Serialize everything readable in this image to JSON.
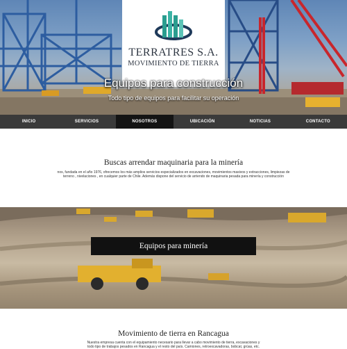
{
  "logo": {
    "title": "TERRATRES S.A.",
    "subtitle": "MOVIMIENTO DE TIERRA"
  },
  "hero": {
    "title": "Equipos para construcción",
    "subtitle": "Todo tipo de equipos para facilitar su operación"
  },
  "nav": {
    "items": [
      "INICIO",
      "SERVICIOS",
      "NOSOTROS",
      "UBICACIÓN",
      "NOTICIAS",
      "CONTACTO"
    ],
    "active_index": 2
  },
  "section1": {
    "title": "Buscas arrendar maquinaria para la minería",
    "text_line1": "nos, fundada en el año 1976, ofrecemos los más amplios servicios especializados en excavaciones, movimientos masivos y extracciones, limpiezas de",
    "text_line2": "terreno , nivelaciones , en cualquier parte de Chile. Además dispone del servicio de arriendo de maquinaria pesada para minería y construcción"
  },
  "mining": {
    "title": "Equipos para minería"
  },
  "section2": {
    "title": "Movimiento de tierra en Rancagua",
    "text_line1": "Nuestra empresa cuenta con el equipamiento necesario para llevar a cabo movimiento de tierra, excavaciones y",
    "text_line2": "todo tipo de trabajos pesados en Rancagua y el resto del país. Camiones, retroexcavadoras, bobcat, grúas, etc."
  },
  "colors": {
    "nav_bg": "#3a3a3a",
    "nav_active": "#141414",
    "logo_text": "#2e3642",
    "logo_teal": "#2a9d8f",
    "logo_navy": "#1f3a5a"
  }
}
